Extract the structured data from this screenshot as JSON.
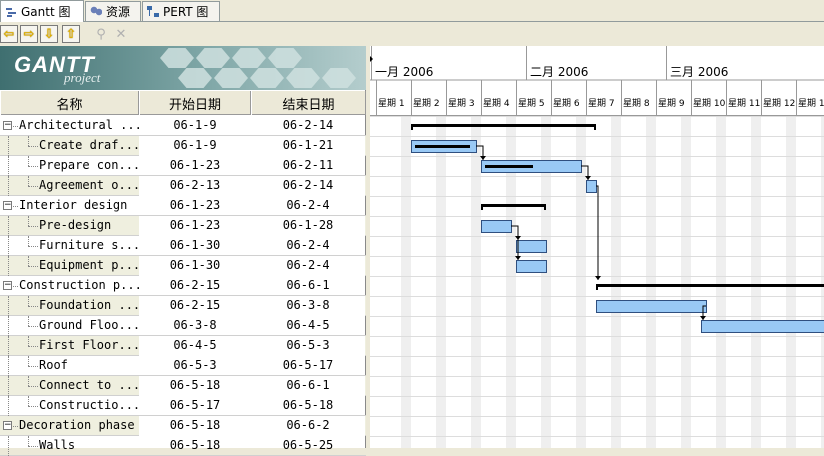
{
  "tabs": [
    {
      "label": "Gantt 图",
      "icon": "gantt-icon",
      "active": true
    },
    {
      "label": "资源",
      "icon": "resources-icon",
      "active": false
    },
    {
      "label": "PERT 图",
      "icon": "pert-icon",
      "active": false
    }
  ],
  "toolbar": {
    "buttons": [
      {
        "icon": "arrow-left-icon",
        "glyph": "⇦"
      },
      {
        "icon": "arrow-right-icon",
        "glyph": "⇨"
      },
      {
        "icon": "arrow-down-icon",
        "glyph": "⇩"
      },
      {
        "icon": "arrow-up-icon",
        "glyph": "⇧"
      },
      {
        "icon": "link-icon",
        "glyph": "⚲"
      },
      {
        "icon": "unlink-icon",
        "glyph": "✕"
      }
    ]
  },
  "logo": {
    "line1": "GANTT",
    "line2": "project"
  },
  "columns": {
    "name": "名称",
    "start": "开始日期",
    "end": "结束日期"
  },
  "tasks": [
    {
      "name": "Architectural ...",
      "start": "06-1-9",
      "end": "06-2-14",
      "level": 0,
      "group": true
    },
    {
      "name": "Create draf...",
      "start": "06-1-9",
      "end": "06-1-21",
      "level": 1
    },
    {
      "name": "Prepare con...",
      "start": "06-1-23",
      "end": "06-2-11",
      "level": 1
    },
    {
      "name": "Agreement o...",
      "start": "06-2-13",
      "end": "06-2-14",
      "level": 1
    },
    {
      "name": "Interior design",
      "start": "06-1-23",
      "end": "06-2-4",
      "level": 0,
      "group": true
    },
    {
      "name": "Pre-design",
      "start": "06-1-23",
      "end": "06-1-28",
      "level": 1
    },
    {
      "name": "Furniture s...",
      "start": "06-1-30",
      "end": "06-2-4",
      "level": 1
    },
    {
      "name": "Equipment p...",
      "start": "06-1-30",
      "end": "06-2-4",
      "level": 1
    },
    {
      "name": "Construction p...",
      "start": "06-2-15",
      "end": "06-6-1",
      "level": 0,
      "group": true
    },
    {
      "name": "Foundation ...",
      "start": "06-2-15",
      "end": "06-3-8",
      "level": 1
    },
    {
      "name": "Ground Floo...",
      "start": "06-3-8",
      "end": "06-4-5",
      "level": 1
    },
    {
      "name": "First Floor...",
      "start": "06-4-5",
      "end": "06-5-3",
      "level": 1
    },
    {
      "name": "Roof",
      "start": "06-5-3",
      "end": "06-5-17",
      "level": 1
    },
    {
      "name": "Connect to ...",
      "start": "06-5-18",
      "end": "06-6-1",
      "level": 1
    },
    {
      "name": "Constructio...",
      "start": "06-5-17",
      "end": "06-5-18",
      "level": 1
    },
    {
      "name": "Decoration phase",
      "start": "06-5-18",
      "end": "06-6-2",
      "level": 0,
      "group": true
    },
    {
      "name": "Walls",
      "start": "06-5-18",
      "end": "06-5-25",
      "level": 1
    }
  ],
  "timeline": {
    "months": [
      "一月 2006",
      "二月 2006",
      "三月 2006"
    ],
    "weeks": [
      "星期 1",
      "星期 2",
      "星期 3",
      "星期 4",
      "星期 5",
      "星期 6",
      "星期 7",
      "星期 8",
      "星期 9",
      "星期 10",
      "星期 11",
      "星期 12",
      "星期 13"
    ]
  },
  "colors": {
    "bar_fill": "#99c9f5",
    "bar_stroke": "#2f4f7f",
    "summary": "#000000",
    "weekend": "#efefef"
  }
}
